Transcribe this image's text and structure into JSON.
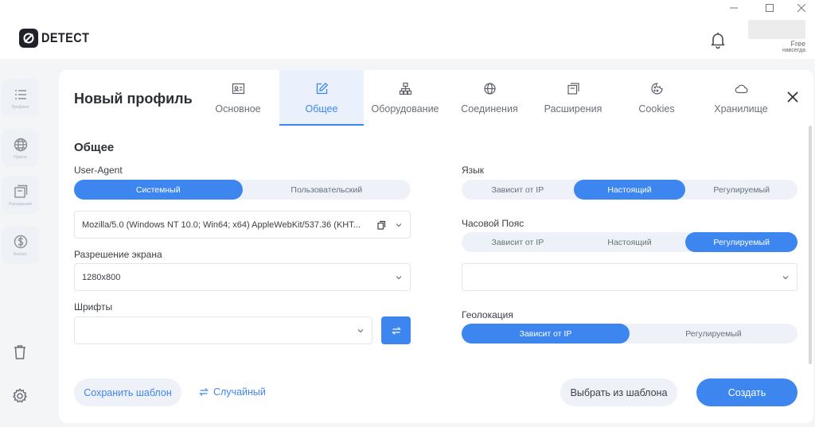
{
  "app": {
    "logo_text": "DETECT",
    "plan": "Free",
    "plan_sub": "навсегда"
  },
  "sidebar": {
    "items": [
      {
        "label": "Профили",
        "icon": "list-icon"
      },
      {
        "label": "Прокси",
        "icon": "globe-icon"
      },
      {
        "label": "Расширения",
        "icon": "extensions-icon"
      },
      {
        "label": "Баланс",
        "icon": "dollar-icon"
      }
    ],
    "bottom": [
      {
        "icon": "trash-icon"
      },
      {
        "icon": "gear-icon"
      }
    ]
  },
  "profile": {
    "title": "Новый профиль",
    "tabs": [
      {
        "label": "Основное",
        "icon": "id-card-icon",
        "active": false
      },
      {
        "label": "Общее",
        "icon": "edit-icon",
        "active": true
      },
      {
        "label": "Оборудование",
        "icon": "hardware-icon",
        "active": false
      },
      {
        "label": "Соединения",
        "icon": "globe-icon",
        "active": false
      },
      {
        "label": "Расширения",
        "icon": "extensions-icon",
        "active": false
      },
      {
        "label": "Cookies",
        "icon": "cookie-icon",
        "active": false
      },
      {
        "label": "Хранилище",
        "icon": "cloud-icon",
        "active": false
      }
    ],
    "section_title": "Общее",
    "user_agent": {
      "label": "User-Agent",
      "options": [
        "Системный",
        "Пользовательский"
      ],
      "selected": "Системный",
      "value": "Mozilla/5.0 (Windows NT 10.0; Win64; x64) AppleWebKit/537.36 (KHT..."
    },
    "resolution": {
      "label": "Разрешение экрана",
      "value": "1280x800"
    },
    "fonts": {
      "label": "Шрифты",
      "value": ""
    },
    "language": {
      "label": "Язык",
      "options": [
        "Зависит от IP",
        "Настоящий",
        "Регулируемый"
      ],
      "selected": "Настоящий"
    },
    "timezone": {
      "label": "Часовой Пояс",
      "options": [
        "Зависит от IP",
        "Настоящий",
        "Регулируемый"
      ],
      "selected": "Регулируемый",
      "value": ""
    },
    "geolocation": {
      "label": "Геолокация",
      "options": [
        "Зависит от IP",
        "Регулируемый"
      ],
      "selected": "Зависит от IP"
    },
    "buttons": {
      "save_template": "Сохранить шаблон",
      "random": "Случайный",
      "choose_template": "Выбрать из шаблона",
      "create": "Создать"
    }
  },
  "colors": {
    "accent": "#3d86f0",
    "segment_bg": "#eef2f8"
  }
}
